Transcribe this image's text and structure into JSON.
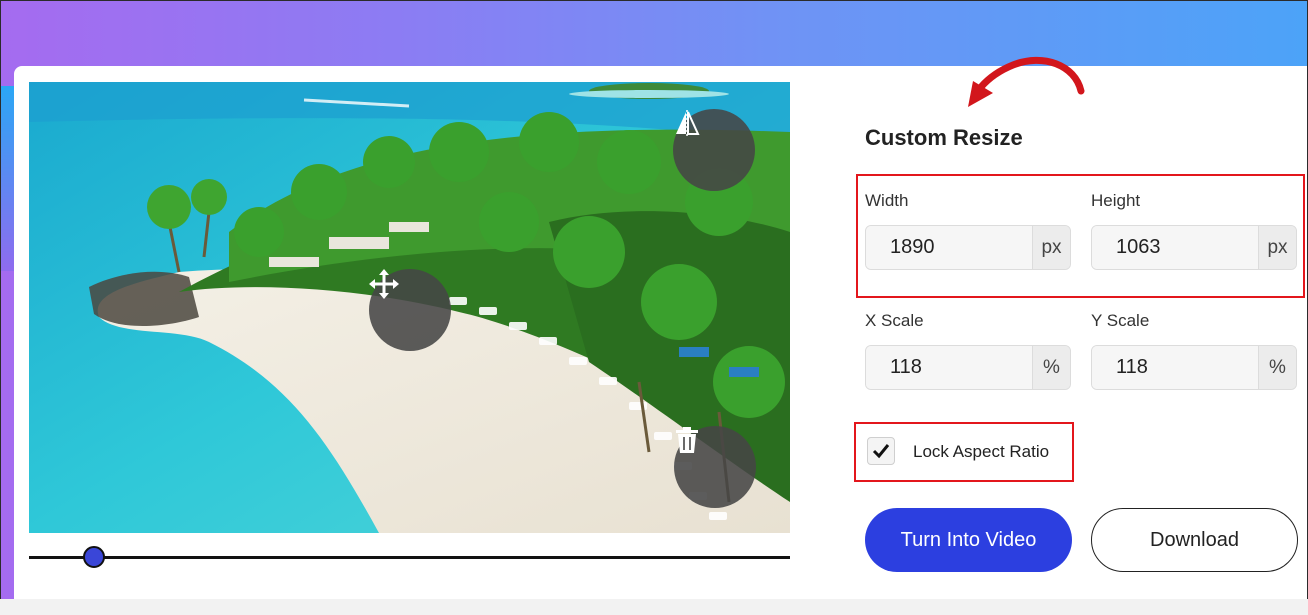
{
  "panel": {
    "title": "Custom Resize",
    "width": {
      "label": "Width",
      "value": "1890",
      "unit": "px"
    },
    "height": {
      "label": "Height",
      "value": "1063",
      "unit": "px"
    },
    "x_scale": {
      "label": "X Scale",
      "value": "118",
      "unit": "%"
    },
    "y_scale": {
      "label": "Y Scale",
      "value": "118",
      "unit": "%"
    },
    "lock_aspect": {
      "label": "Lock Aspect Ratio",
      "checked": true
    }
  },
  "actions": {
    "turn_into_video": "Turn Into Video",
    "download": "Download"
  },
  "image_tools": {
    "flip_icon": "flip-icon",
    "move_icon": "move-icon",
    "delete_icon": "trash-icon"
  },
  "slider": {
    "value_fraction": 0.085
  },
  "colors": {
    "primary_button": "#2c3fe0",
    "annotation_red": "#e3161c",
    "slider_thumb": "#3a46d8"
  }
}
